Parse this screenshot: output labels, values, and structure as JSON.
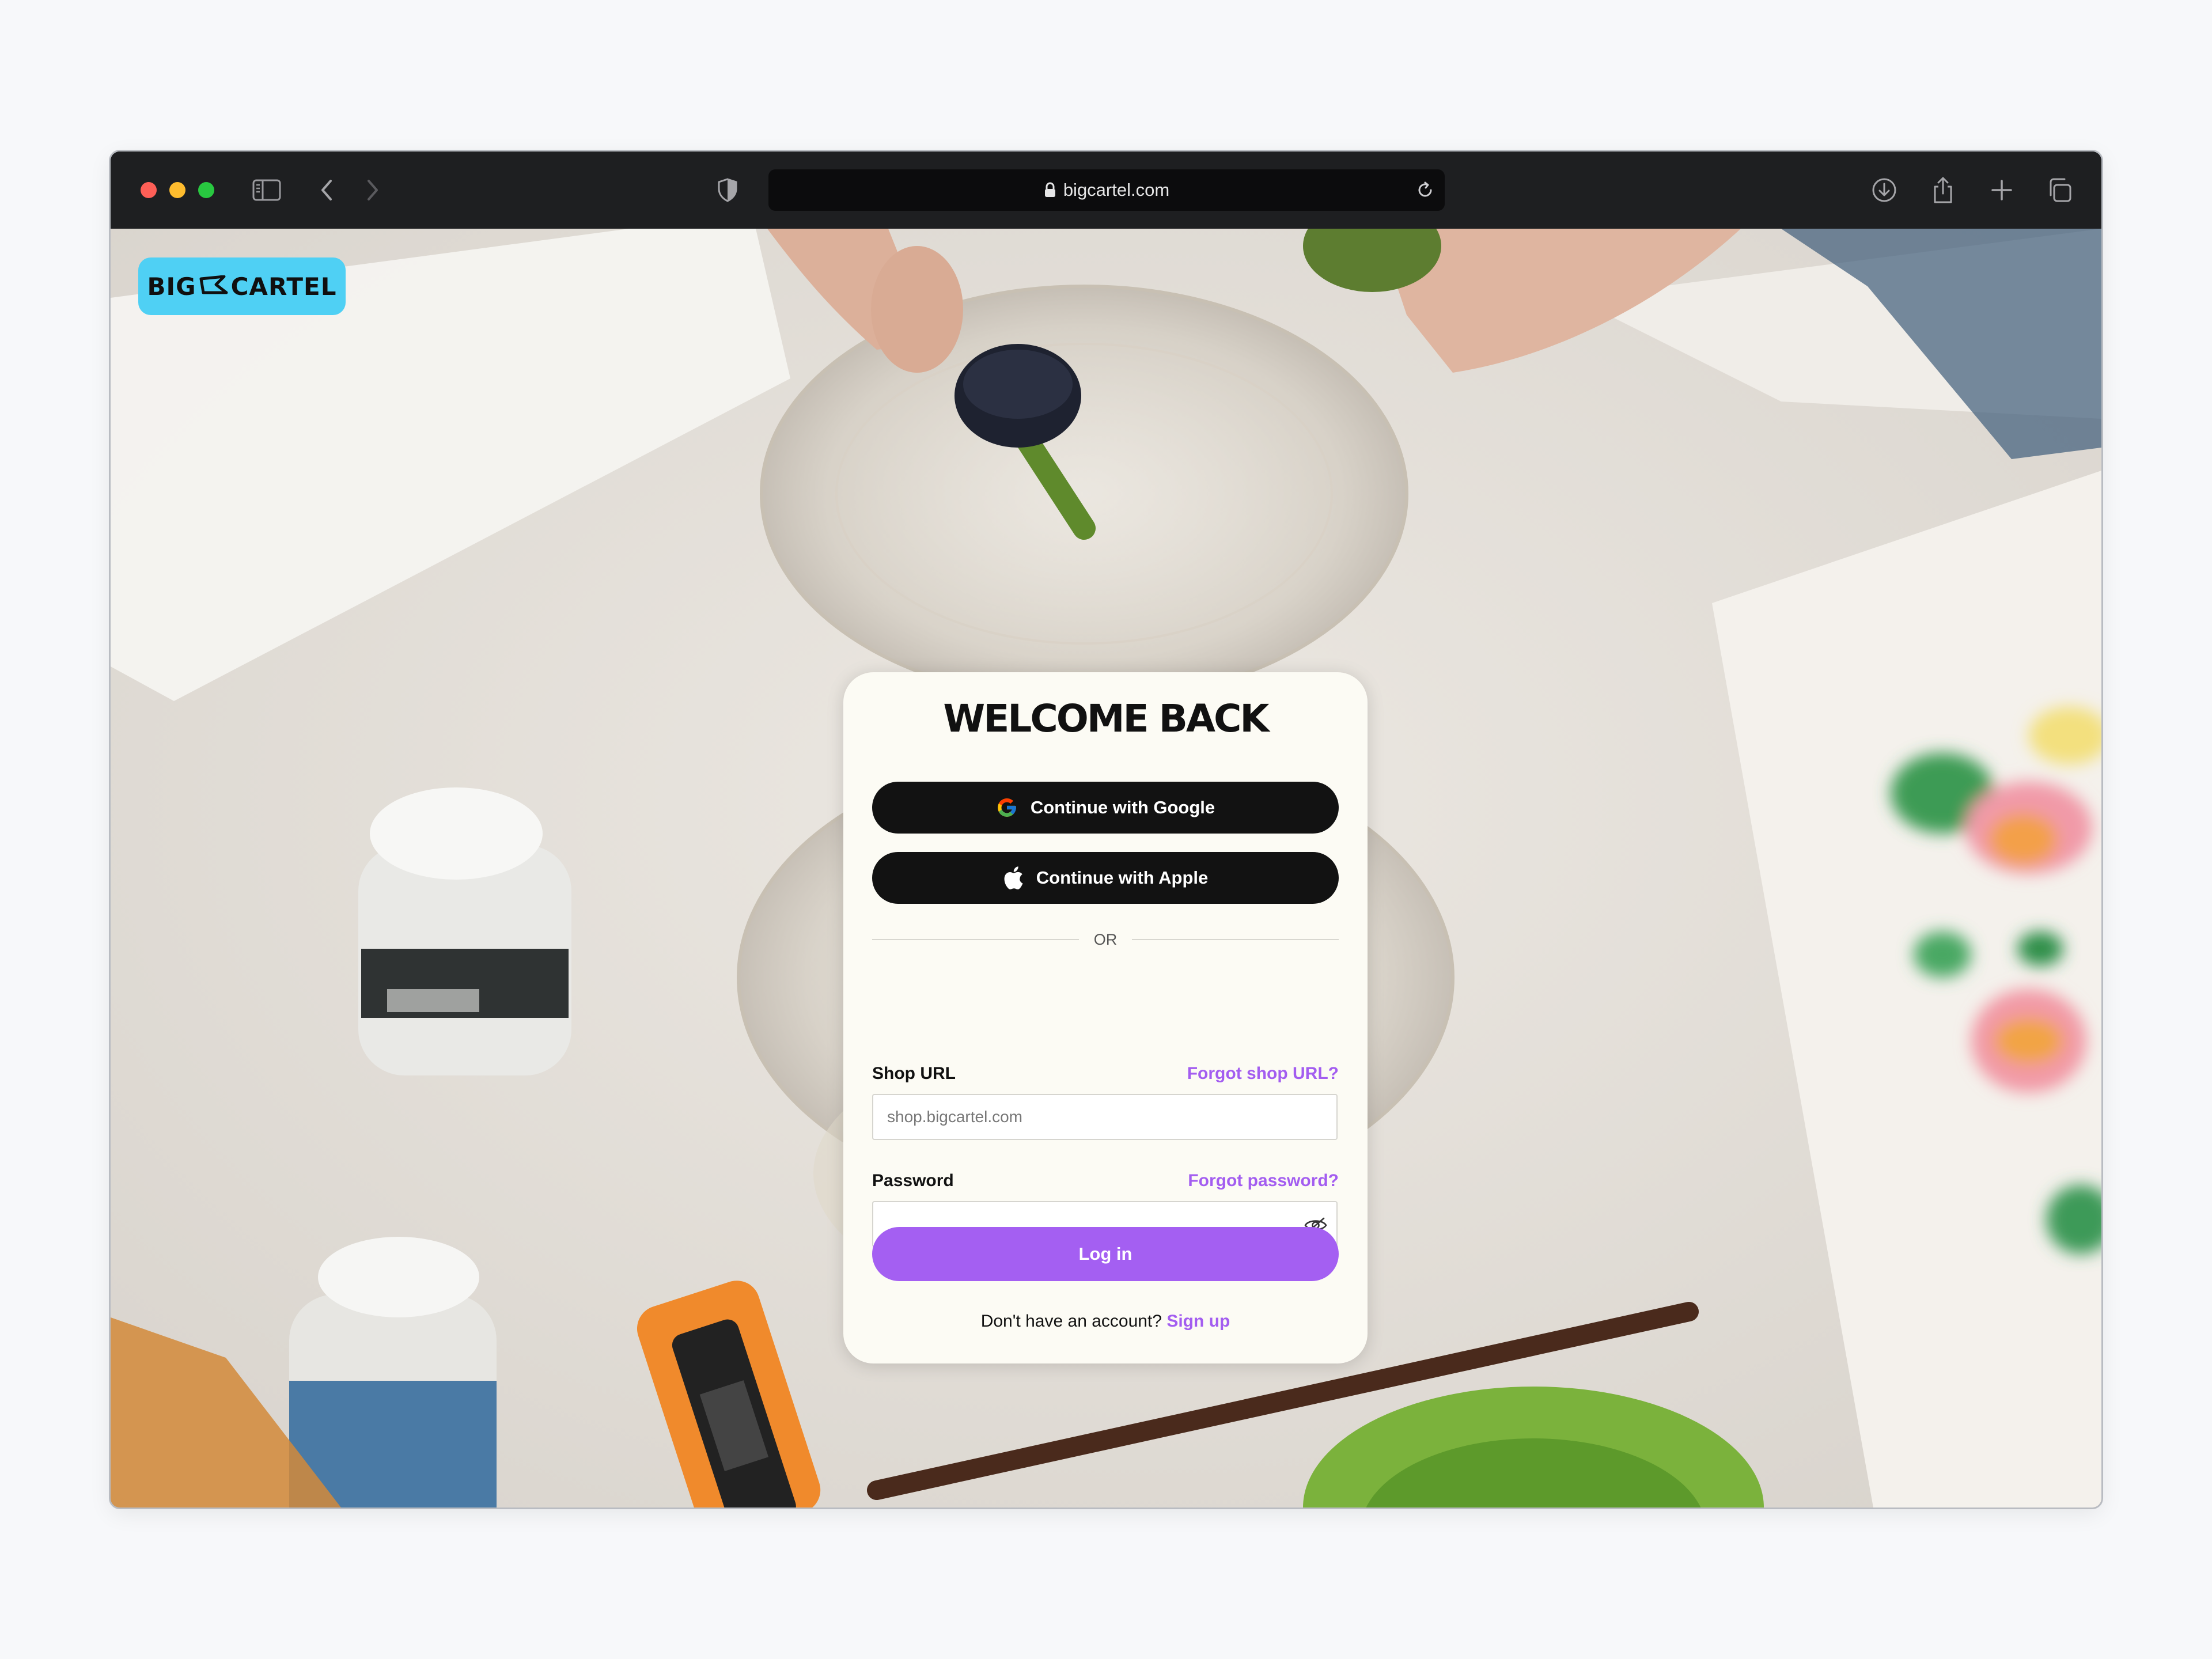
{
  "browser": {
    "url": "bigcartel.com",
    "traffic_colors": {
      "close": "#fe5f57",
      "minimize": "#febc2e",
      "zoom": "#28c840"
    }
  },
  "logo": {
    "left": "BIG",
    "right": "CARTEL",
    "color": "#4fd0f4"
  },
  "login": {
    "title": "WELCOME BACK",
    "google_label": "Continue with Google",
    "apple_label": "Continue with Apple",
    "divider": "OR",
    "shop_url_label": "Shop URL",
    "forgot_shop_url": "Forgot shop URL?",
    "shop_url_placeholder": "shop.bigcartel.com",
    "shop_url_value": "",
    "password_label": "Password",
    "forgot_password": "Forgot password?",
    "password_value": "",
    "login_label": "Log in",
    "signup_prompt": "Don't have an account?",
    "signup_link": "Sign up",
    "accent_color": "#a45ff2"
  }
}
